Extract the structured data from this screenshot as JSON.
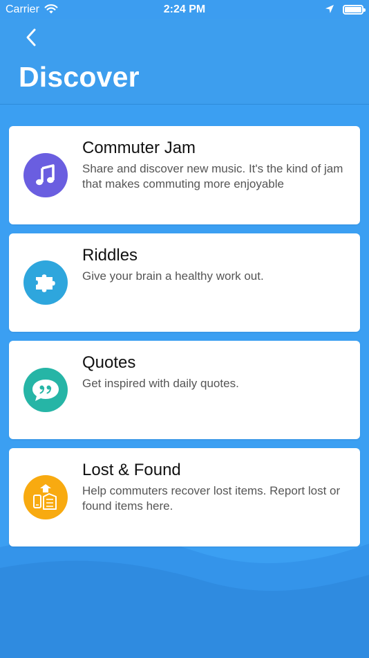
{
  "status_bar": {
    "carrier": "Carrier",
    "time": "2:24 PM"
  },
  "header": {
    "title": "Discover"
  },
  "colors": {
    "header_bg": "#3d9eee",
    "content_bg": "#3b9ff2",
    "music": "#6a5ee0",
    "riddles": "#2ea6dd",
    "quotes": "#26b5a6",
    "lost_found": "#f8aa10"
  },
  "cards": [
    {
      "title": "Commuter Jam",
      "description": "Share and discover new music. It's the kind of jam that makes commuting more enjoyable",
      "icon": "music-note-icon"
    },
    {
      "title": "Riddles",
      "description": "Give your brain a healthy work out.",
      "icon": "puzzle-piece-icon"
    },
    {
      "title": "Quotes",
      "description": "Get inspired with daily quotes.",
      "icon": "quote-bubble-icon"
    },
    {
      "title": "Lost & Found",
      "description": "Help commuters recover lost items. Report lost or found items here.",
      "icon": "lost-items-icon"
    }
  ]
}
